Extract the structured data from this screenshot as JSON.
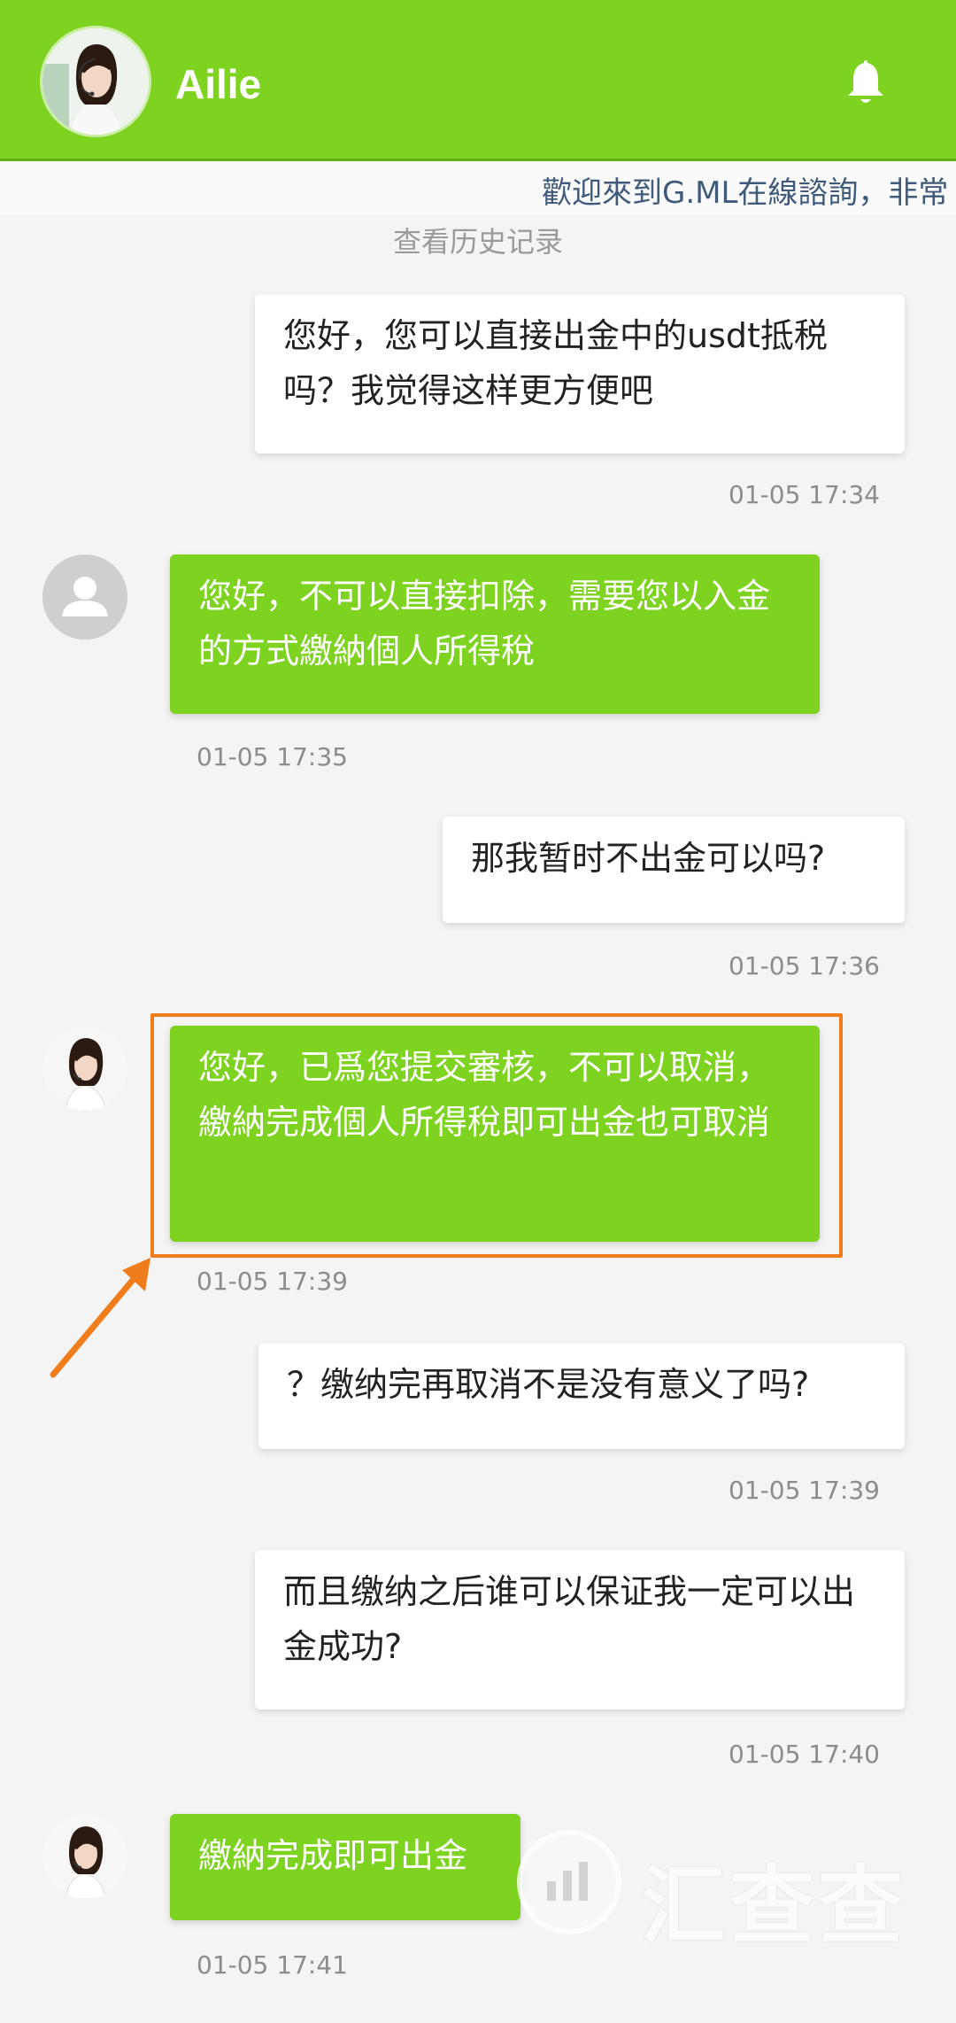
{
  "header": {
    "title": "Ailie",
    "bell_icon": "bell-icon"
  },
  "marquee": {
    "text": "歡迎來到G.ML在線諮詢，非常"
  },
  "history_link": "查看历史记录",
  "messages": [
    {
      "sender": "user",
      "text": "您好，您可以直接出金中的usdt抵税吗？我觉得这样更方便吧",
      "time": "01-05 17:34"
    },
    {
      "sender": "agent",
      "text": "您好，不可以直接扣除，需要您以入金的方式繳納個人所得稅",
      "time": "01-05 17:35"
    },
    {
      "sender": "user",
      "text": "那我暂时不出金可以吗?",
      "time": "01-05 17:36"
    },
    {
      "sender": "agent",
      "text": "您好，已爲您提交審核，不可以取消，繳納完成個人所得稅即可出金也可取消",
      "time": "01-05 17:39"
    },
    {
      "sender": "user",
      "text": "？缴纳完再取消不是没有意义了吗?",
      "time": "01-05 17:39"
    },
    {
      "sender": "user",
      "text": "而且缴纳之后谁可以保证我一定可以出金成功?",
      "time": "01-05 17:40"
    },
    {
      "sender": "agent",
      "text": "繳納完成即可出金",
      "time": "01-05 17:41"
    }
  ],
  "watermark": {
    "text": "汇查查"
  },
  "colors": {
    "accent": "#7ed321",
    "highlight": "#f07d1b"
  }
}
